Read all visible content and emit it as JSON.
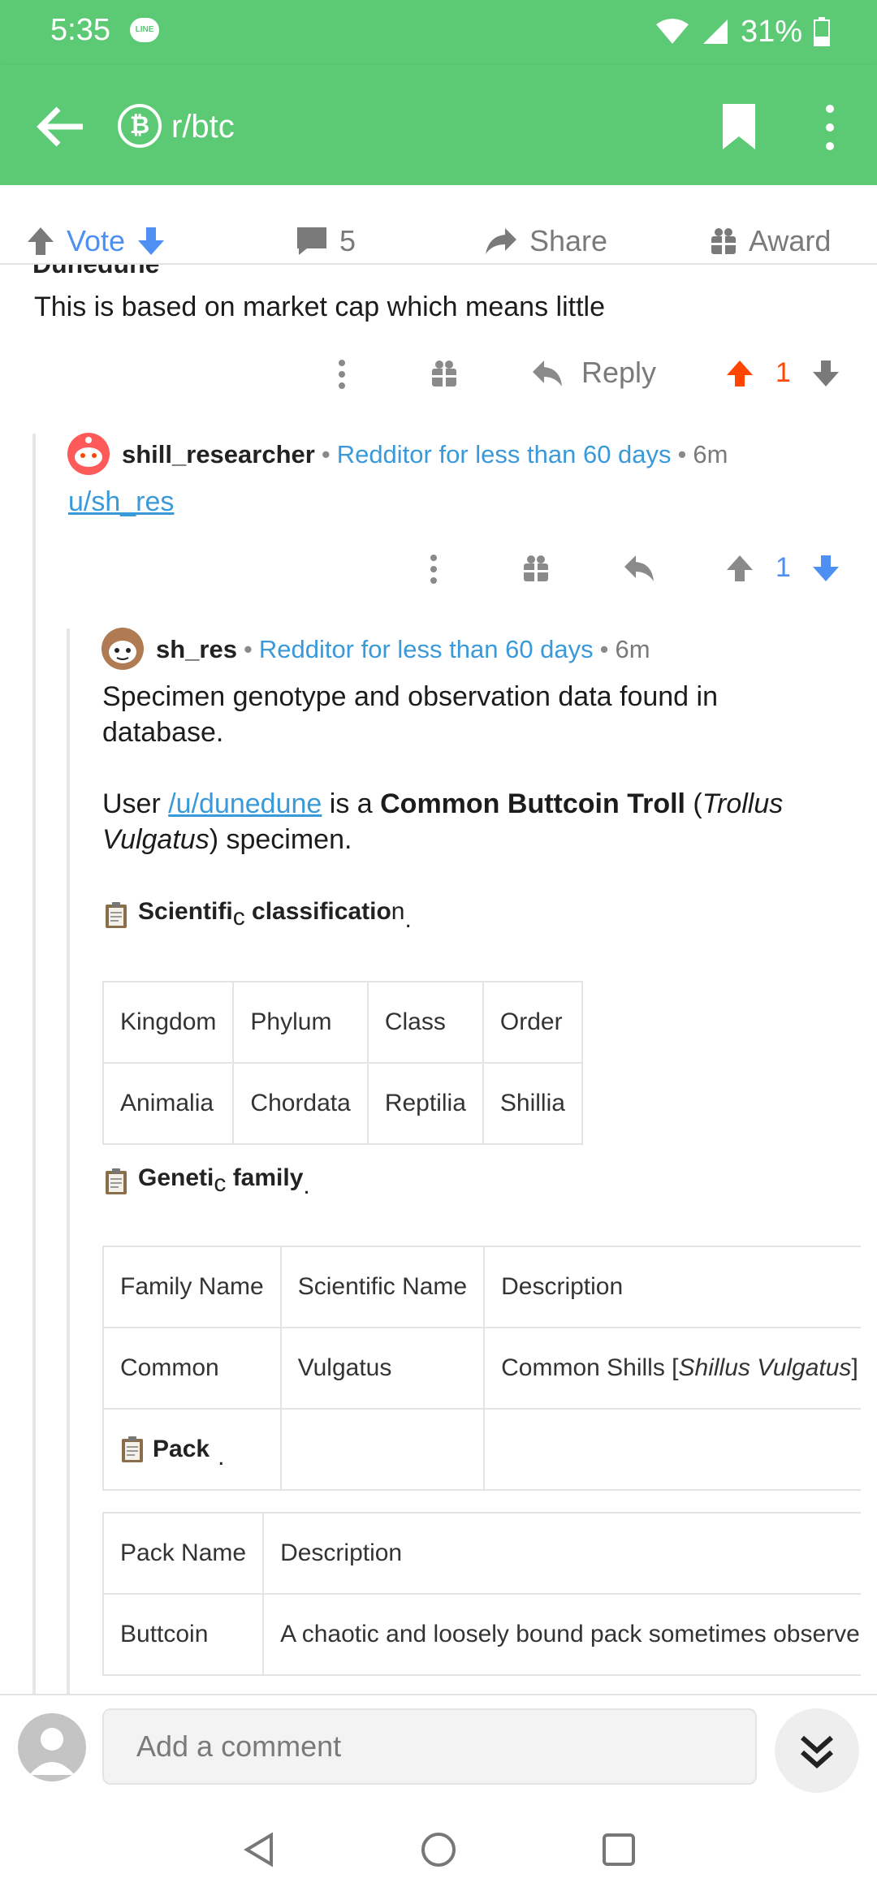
{
  "status": {
    "time": "5:35",
    "line_badge": "LINE",
    "battery": "31%"
  },
  "header": {
    "subreddit": "r/btc"
  },
  "actions": {
    "vote": "Vote",
    "comments_count": "5",
    "share": "Share",
    "award": "Award"
  },
  "comment1": {
    "author_partial": "Dunedune",
    "text": "This is based on market cap which means little",
    "reply": "Reply",
    "score": "1"
  },
  "comment2": {
    "author": "shill_researcher",
    "flair": "Redditor for less than 60 days",
    "age": "6m",
    "text": "u/sh_res",
    "score": "1"
  },
  "comment3": {
    "author": "sh_res",
    "flair": "Redditor for less than 60 days",
    "age": "6m",
    "p1": "Specimen genotype and observation data found in database.",
    "p2_pre": "User ",
    "p2_link": "/u/dunedune",
    "p2_mid": " is a ",
    "p2_bold": "Common Buttcoin Troll",
    "p2_paren_open": " (",
    "p2_italic": "Trollus Vulgatus",
    "p2_end": ") specimen.",
    "h1_a": "Scientifi",
    "h1_sub": "c",
    "h1_b": " classificatio",
    "h1_c": "n",
    "h1_dot": ".",
    "classification": {
      "headers": [
        "Kingdom",
        "Phylum",
        "Class",
        "Order"
      ],
      "row": [
        "Animalia",
        "Chordata",
        "Reptilia",
        "Shillia"
      ]
    },
    "h2_a": "Geneti",
    "h2_sub": "c",
    "h2_b": " family",
    "h2_dot": ".",
    "family": {
      "headers": [
        "Family Name",
        "Scientific Name",
        "Description"
      ],
      "row": [
        "Common",
        "Vulgatus"
      ],
      "desc_pre": "Common Shills [",
      "desc_italic": "Shillus Vulgatus",
      "desc_post": "] a"
    },
    "h3": "Pack",
    "h3_dot": ".",
    "pack": {
      "headers": [
        "Pack Name",
        "Description"
      ],
      "row": [
        "Buttcoin",
        "A chaotic and loosely bound pack sometimes observed"
      ]
    }
  },
  "composer": {
    "placeholder": "Add a comment"
  },
  "colors": {
    "brand_green": "#5cc975",
    "upvote_orange": "#ff4500",
    "downvote_blue": "#4d8ff2",
    "link_blue": "#3a9ad9"
  }
}
